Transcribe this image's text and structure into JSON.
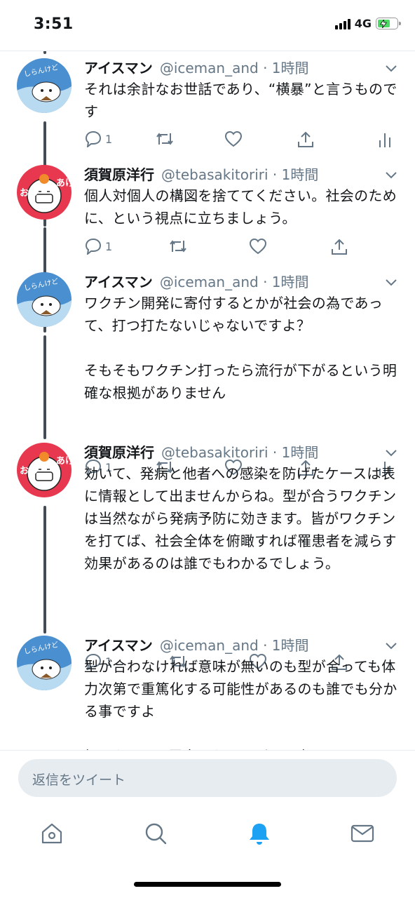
{
  "status": {
    "time": "3:51",
    "network": "4G"
  },
  "thread": {
    "tweets": [
      {
        "name": "アイスマン",
        "handle": "@iceman_and · 1時間",
        "text": "それは余計なお世話であり、“横暴”と言うものです",
        "reply_count": "1",
        "has_analytics": true
      },
      {
        "name": "須賀原洋行",
        "handle": "@tebasakitoriri · 1時間",
        "text": "個人対個人の構図を捨ててください。社会のために、という視点に立ちましょう。",
        "reply_count": "1",
        "has_analytics": false
      },
      {
        "name": "アイスマン",
        "handle": "@iceman_and · 1時間",
        "text": "ワクチン開発に寄付するとかが社会の為であって、打つ打たないじゃないですよ？\n\nそもそもワクチン打ったら流行が下がるという明確な根拠がありません",
        "reply_count": "1",
        "has_analytics": true
      },
      {
        "name": "須賀原洋行",
        "handle": "@tebasakitoriri · 1時間",
        "text": "効いて、発病と他者への感染を防げたケースは表に情報として出ませんからね。型が合うワクチンは当然ながら発病予防に効きます。皆がワクチンを打てば、社会全体を俯瞰すれば罹患者を減らす効果があるのは誰でもわかるでしょう。",
        "reply_count": "1",
        "has_analytics": false
      },
      {
        "name": "アイスマン",
        "handle": "@iceman_and · 1時間",
        "text": "型が合わなければ意味が無いのも型が合っても体力次第で重篤化する可能性があるのも誰でも分かる事ですよ\n\n打たなくても罹患しなければ同じ事ですしね",
        "reply_count": "",
        "has_analytics": true
      }
    ],
    "avatars": {
      "iceman_text": "しらんけど",
      "suga_text_left": "おめ",
      "suga_text_right": "あけ"
    }
  },
  "reply": {
    "placeholder": "返信をツイート"
  },
  "tabs": [
    "home-icon",
    "search-icon",
    "notifications-icon",
    "messages-icon"
  ],
  "colors": {
    "accent": "#1da1f2",
    "muted": "#657786",
    "thread_line": "#434c55"
  }
}
